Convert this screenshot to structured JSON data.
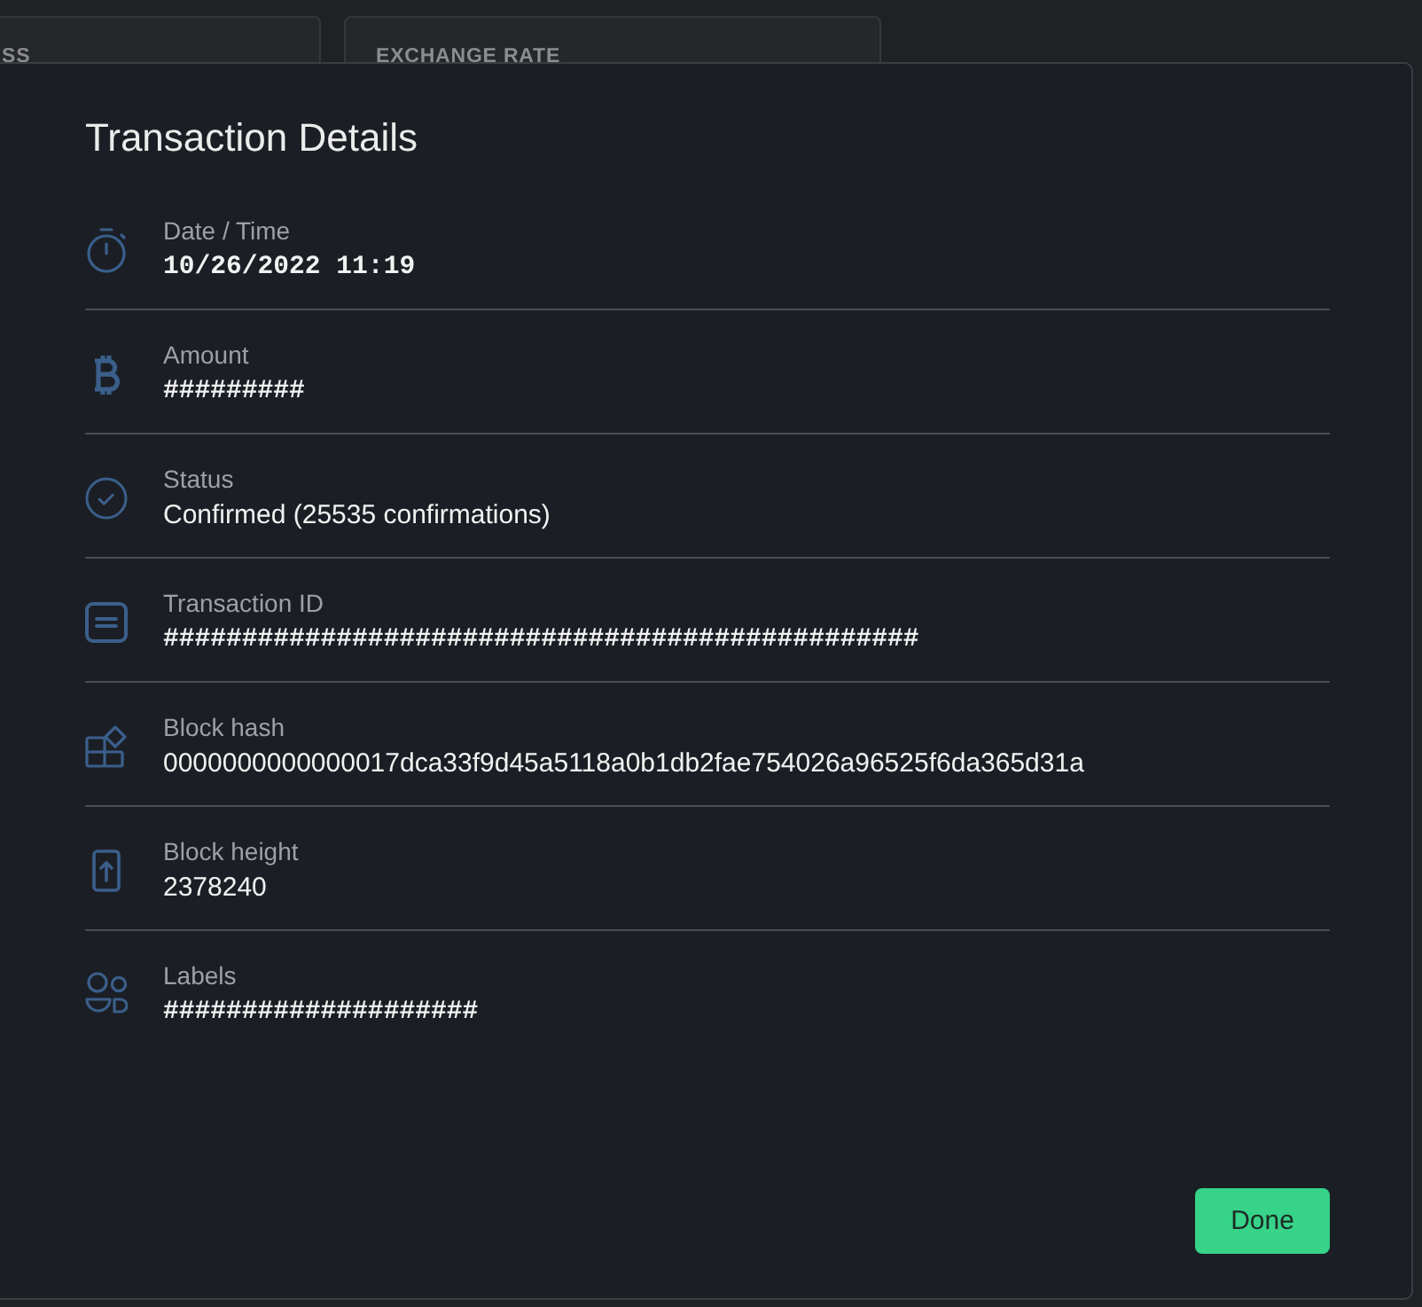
{
  "background_cards": [
    {
      "label": "SS"
    },
    {
      "label": "EXCHANGE RATE"
    }
  ],
  "dialog": {
    "title": "Transaction Details",
    "fields": [
      {
        "kind": "date",
        "label": "Date / Time",
        "value": "10/26/2022 11:19"
      },
      {
        "kind": "amount",
        "label": "Amount",
        "value": "#########"
      },
      {
        "kind": "status",
        "label": "Status",
        "value": "Confirmed (25535 confirmations)"
      },
      {
        "kind": "transaction_id",
        "label": "Transaction ID",
        "value": "################################################"
      },
      {
        "kind": "block_hash",
        "label": "Block hash",
        "value": "0000000000000017dca33f9d45a5118a0b1db2fae754026a96525f6da365d31a"
      },
      {
        "kind": "block_height",
        "label": "Block height",
        "value": "2378240"
      },
      {
        "kind": "labels",
        "label": "Labels",
        "value": "####################"
      }
    ],
    "done_button": "Done"
  }
}
